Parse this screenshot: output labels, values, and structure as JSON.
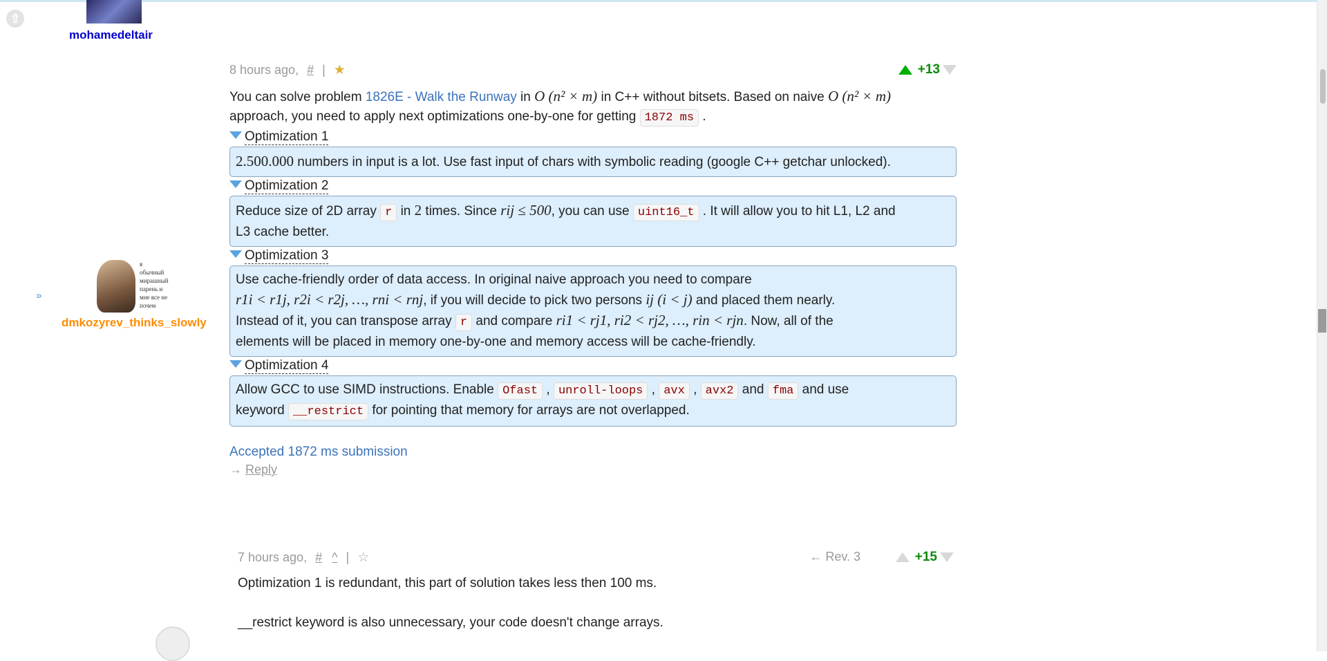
{
  "top_user": {
    "name": "mohamedeltair"
  },
  "main_user": {
    "name": "dmkozyrev_thinks_slowly",
    "avatar_text": [
      "я",
      "обычный",
      "мирашный",
      "парень и",
      "мне все не",
      "почем"
    ]
  },
  "expand_label": "»",
  "comment1": {
    "time": "8 hours ago,",
    "hash": "#",
    "sep": "|",
    "vote": "+13",
    "intro": {
      "p1": "You can solve problem ",
      "problem_link": "1826E - Walk the Runway",
      "p2": " in ",
      "complexity1": "O (n² × m)",
      "p3": " in C++ without bitsets. Based on naive ",
      "complexity2": "O (n² × m)",
      "p4": "approach, you need to apply next optimizations one-by-one for getting ",
      "time_code": "1872 ms",
      "p5": " ."
    },
    "opt1": {
      "title": "Optimization 1",
      "num": "2.500.000",
      "text": " numbers in input is a lot. Use fast input of chars with symbolic reading (google C++ getchar unlocked)."
    },
    "opt2": {
      "title": "Optimization 2",
      "t1": "Reduce size of 2D array ",
      "code1": "r",
      "t2": " in ",
      "m1": "2",
      "t3": " times. Since ",
      "m2": "rij ≤ 500",
      "t4": ", you can use ",
      "code2": "uint16_t",
      "t5": " . It will allow you to hit L1, L2 and",
      "t6": "L3 cache better."
    },
    "opt3": {
      "title": "Optimization 3",
      "l1": "Use cache-friendly order of data access. In original naive approach you need to compare",
      "m1": "r1i < r1j, r2i < r2j, …, rni < rnj",
      "t2": ", if you will decide to pick two persons ",
      "m2": "ij  (i < j)",
      "t3": " and placed them nearly.",
      "t4": "Instead of it, you can transpose array ",
      "code1": "r",
      "t5": " and compare ",
      "m3": "ri1 < rj1, ri2 < rj2, …, rin < rjn",
      "t6": ". Now, all of the",
      "l4": "elements will be placed in memory one-by-one and memory access will be cache-friendly."
    },
    "opt4": {
      "title": "Optimization 4",
      "t1": "Allow GCC to use SIMD instructions. Enable ",
      "c1": "Ofast",
      "s1": " , ",
      "c2": "unroll-loops",
      "s2": " , ",
      "c3": "avx",
      "s3": " , ",
      "c4": "avx2",
      "s4": " and ",
      "c5": "fma",
      "t2": " and use",
      "t3": "keyword ",
      "c6": "__restrict",
      "t4": " for pointing that memory for arrays are not overlapped."
    },
    "accepted": "Accepted 1872 ms submission",
    "reply_arrow": "→",
    "reply": "Reply"
  },
  "comment2": {
    "time": "7 hours ago,",
    "hash": "#",
    "caret": "^",
    "sep": "|",
    "rev": "← Rev. 3",
    "vote": "+15",
    "line1": "Optimization 1 is redundant, this part of solution takes less then 100 ms.",
    "line2": "__restrict keyword is also unnecessary, your code doesn't change arrays."
  },
  "colors": {
    "spoiler_bg": "#ddeefc",
    "link": "#3b73b9",
    "vote_green": "#0a8a0a",
    "user_orange": "#ff8c00",
    "user_blue": "#0000cc"
  }
}
